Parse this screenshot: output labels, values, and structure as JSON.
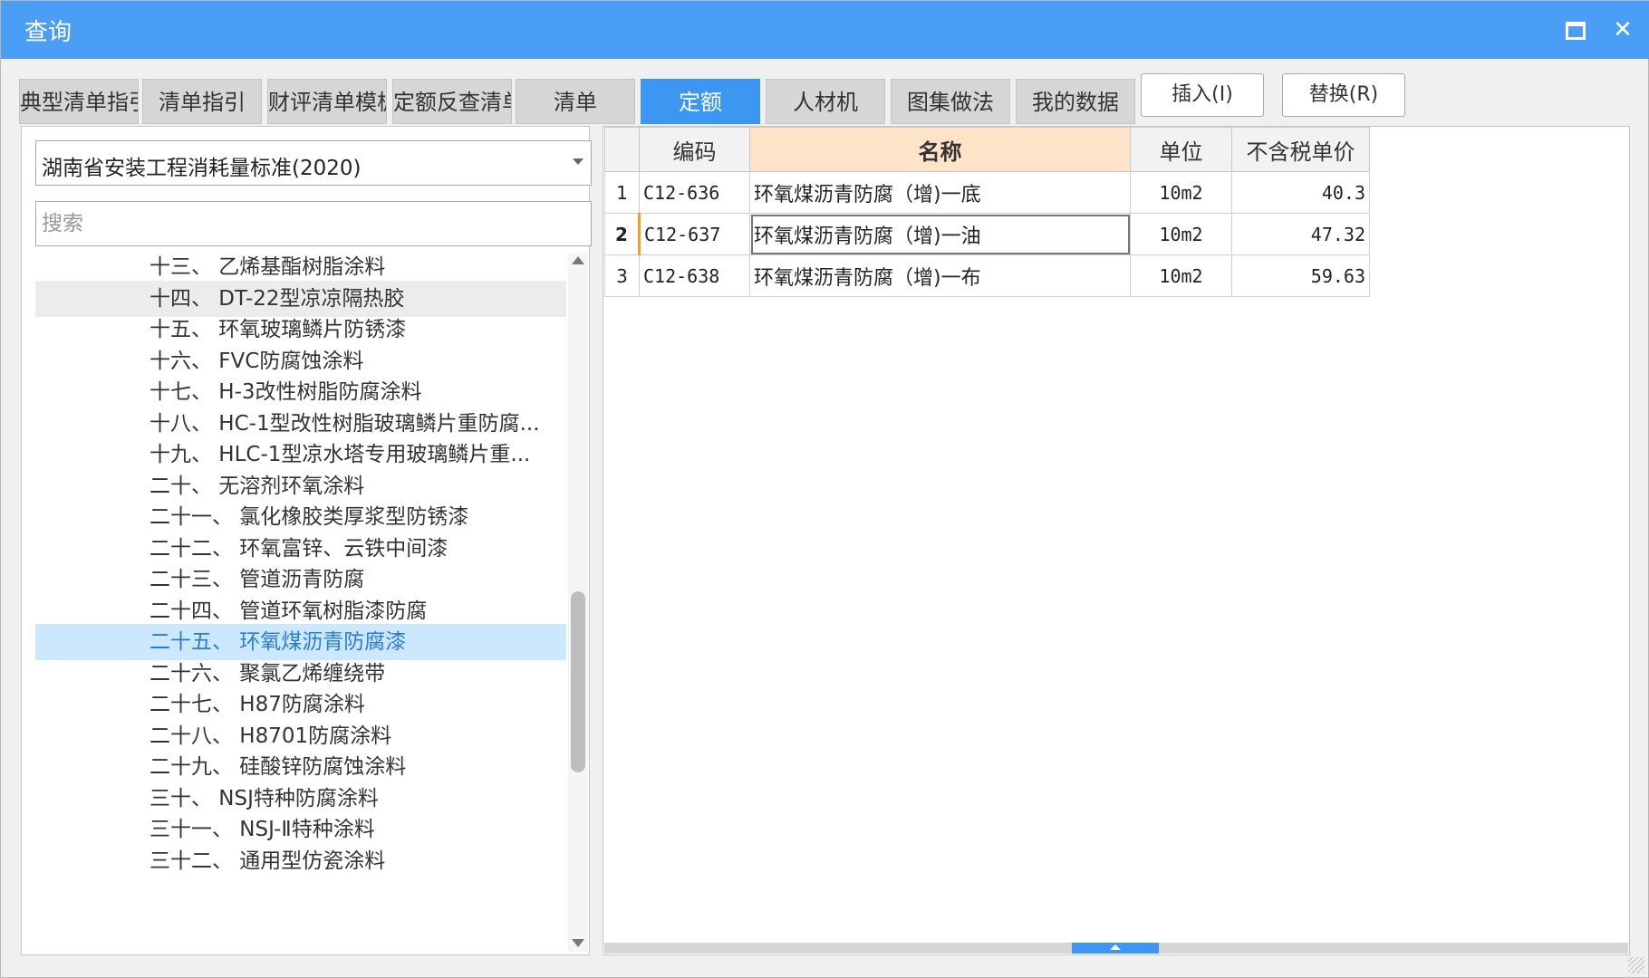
{
  "window": {
    "title": "查询"
  },
  "tabs": [
    {
      "label": "典型清单指引",
      "active": false
    },
    {
      "label": "清单指引",
      "active": false
    },
    {
      "label": "财评清单模板",
      "active": false
    },
    {
      "label": "定额反查清单",
      "active": false
    },
    {
      "label": "清单",
      "active": false
    },
    {
      "label": "定额",
      "active": true
    },
    {
      "label": "人材机",
      "active": false
    },
    {
      "label": "图集做法",
      "active": false
    },
    {
      "label": "我的数据",
      "active": false
    }
  ],
  "actions": {
    "insert_label": "插入(I)",
    "replace_label": "替换(R)"
  },
  "left": {
    "standard_selected": "湖南省安装工程消耗量标准(2020)",
    "search_placeholder": "搜索",
    "tree_items": [
      "十三、 乙烯基酯树脂涂料",
      "十四、 DT-22型凉凉隔热胶",
      "十五、 环氧玻璃鳞片防锈漆",
      "十六、 FVC防腐蚀涂料",
      "十七、 H-3改性树脂防腐涂料",
      "十八、 HC-1型改性树脂玻璃鳞片重防腐...",
      "十九、 HLC-1型凉水塔专用玻璃鳞片重...",
      "二十、 无溶剂环氧涂料",
      "二十一、 氯化橡胶类厚浆型防锈漆",
      "二十二、 环氧富锌、云铁中间漆",
      "二十三、 管道沥青防腐",
      "二十四、 管道环氧树脂漆防腐",
      "二十五、 环氧煤沥青防腐漆",
      "二十六、 聚氯乙烯缠绕带",
      "二十七、 H87防腐涂料",
      "二十八、 H8701防腐涂料",
      "二十九、 硅酸锌防腐蚀涂料",
      "三十、 NSJ特种防腐涂料",
      "三十一、 NSJ-Ⅱ特种涂料",
      "三十二、 通用型仿瓷涂料"
    ],
    "hover_index": 1,
    "selected_index": 12
  },
  "grid": {
    "columns": [
      "",
      "编码",
      "名称",
      "单位",
      "不含税单价"
    ],
    "rows": [
      {
        "num": "1",
        "code": "C12-636",
        "name": "环氧煤沥青防腐（增)一底",
        "unit": "10m2",
        "price": "40.3"
      },
      {
        "num": "2",
        "code": "C12-637",
        "name": "环氧煤沥青防腐（增)一油",
        "unit": "10m2",
        "price": "47.32"
      },
      {
        "num": "3",
        "code": "C12-638",
        "name": "环氧煤沥青防腐（增)一布",
        "unit": "10m2",
        "price": "59.63"
      }
    ],
    "current_row": 1
  },
  "colors": {
    "accent": "#3c97f2",
    "titlebar": "#4a9ef5",
    "header_highlight": "#fde4c8",
    "selection": "#cce8ff"
  }
}
